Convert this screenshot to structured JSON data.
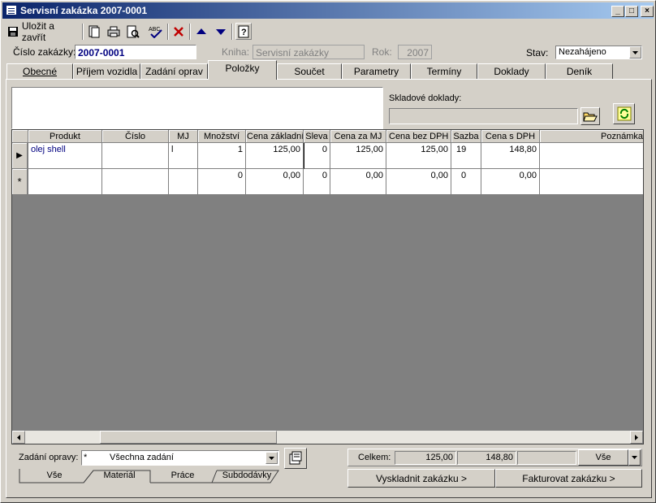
{
  "window": {
    "title": "Servisní zakázka 2007-0001",
    "min": "_",
    "max": "□",
    "close": "×"
  },
  "toolbar": {
    "save_close": "Uložit a zavřít",
    "icons": [
      "save-icon",
      "copy-icon",
      "print-icon",
      "print-preview-icon",
      "spellcheck-icon",
      "delete-icon",
      "up-arrow-icon",
      "down-arrow-icon",
      "help-icon"
    ]
  },
  "header": {
    "order_label": "Číslo zakázky:",
    "order_value": "2007-0001",
    "book_label": "Kniha:",
    "book_value": "Servisní zakázky",
    "year_label": "Rok:",
    "year_value": "2007",
    "state_label": "Stav:",
    "state_value": "Nezahájeno"
  },
  "tabs": [
    "Obecné",
    "Příjem vozidla",
    "Zadání oprav",
    "Položky",
    "Součet",
    "Parametry",
    "Termíny",
    "Doklady",
    "Deník"
  ],
  "active_tab": "Položky",
  "stock_docs": {
    "label": "Skladové doklady:",
    "value": ""
  },
  "grid": {
    "columns": [
      "Produkt",
      "Číslo",
      "MJ",
      "Množství",
      "Cena základní",
      "Sleva",
      "Cena za MJ",
      "Cena bez DPH",
      "Sazba",
      "Cena s DPH",
      "Poznámka"
    ],
    "rows": [
      [
        "olej shell",
        "",
        "l",
        "1",
        "125,00",
        "0",
        "125,00",
        "125,00",
        "19",
        "148,80",
        ""
      ],
      [
        "",
        "",
        "",
        "0",
        "0,00",
        "0",
        "0,00",
        "0,00",
        "0",
        "0,00",
        ""
      ]
    ],
    "row_markers": [
      "▶",
      "*"
    ]
  },
  "footer": {
    "repair_label": "Zadání opravy:",
    "repair_marker": "*",
    "repair_value": "Všechna zadání",
    "bottom_tabs": [
      "Vše",
      "Materiál",
      "Práce",
      "Subdodávky"
    ],
    "total_label": "Celkem:",
    "total_without_vat": "125,00",
    "total_with_vat": "148,80",
    "total_extra": "",
    "filter_value": "Vše",
    "stock_button": "Vyskladnit zakázku >",
    "invoice_button": "Fakturovat zakázku >"
  }
}
